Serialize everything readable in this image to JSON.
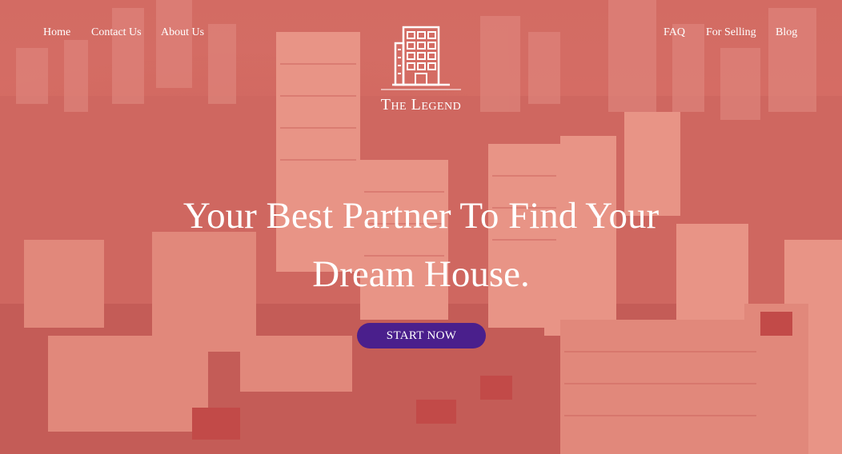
{
  "nav": {
    "left": [
      {
        "label": "Home"
      },
      {
        "label": "Contact Us"
      },
      {
        "label": "About Us"
      }
    ],
    "right": [
      {
        "label": "FAQ"
      },
      {
        "label": "For Selling"
      },
      {
        "label": "Blog"
      }
    ]
  },
  "brand": {
    "name": "The Legend",
    "icon": "building-icon"
  },
  "hero": {
    "headline_line1": "Your Best Partner To Find Your",
    "headline_line2": "Dream House.",
    "cta_label": "START NOW",
    "background": "aerial-city-photo"
  },
  "colors": {
    "overlay": "#e0786e",
    "cta": "#4a1f8c",
    "text": "#ffffff"
  }
}
